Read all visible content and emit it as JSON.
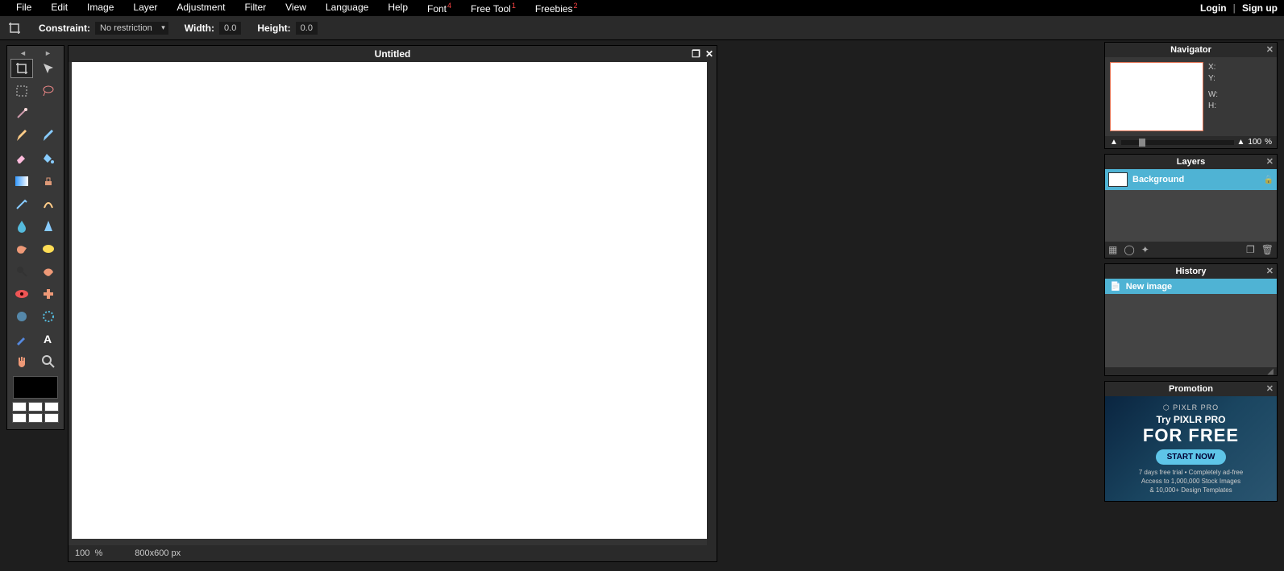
{
  "menubar": {
    "items": [
      "File",
      "Edit",
      "Image",
      "Layer",
      "Adjustment",
      "Filter",
      "View",
      "Language",
      "Help",
      "Font",
      "Free Tool",
      "Freebies"
    ],
    "badges": {
      "9": "4",
      "10": "1",
      "11": "2"
    },
    "login": "Login",
    "signup": "Sign up"
  },
  "options": {
    "constraint_label": "Constraint:",
    "constraint_value": "No restriction",
    "width_label": "Width:",
    "width_value": "0.0",
    "height_label": "Height:",
    "height_value": "0.0"
  },
  "canvas": {
    "title": "Untitled",
    "zoom": "100",
    "zoom_unit": "%",
    "dimensions": "800x600 px"
  },
  "navigator": {
    "title": "Navigator",
    "x": "X:",
    "y": "Y:",
    "w": "W:",
    "h": "H:",
    "zoom": "100",
    "zoom_unit": "%"
  },
  "layers": {
    "title": "Layers",
    "items": [
      {
        "name": "Background"
      }
    ]
  },
  "history": {
    "title": "History",
    "items": [
      {
        "name": "New image"
      }
    ]
  },
  "promotion": {
    "title": "Promotion",
    "logo": "⬡ PIXLR PRO",
    "try": "Try PIXLR PRO",
    "free": "FOR FREE",
    "button": "START NOW",
    "line1": "7 days free trial • Completely ad-free",
    "line2": "Access to 1,000,000 Stock Images",
    "line3": "& 10,000+ Design Templates"
  }
}
